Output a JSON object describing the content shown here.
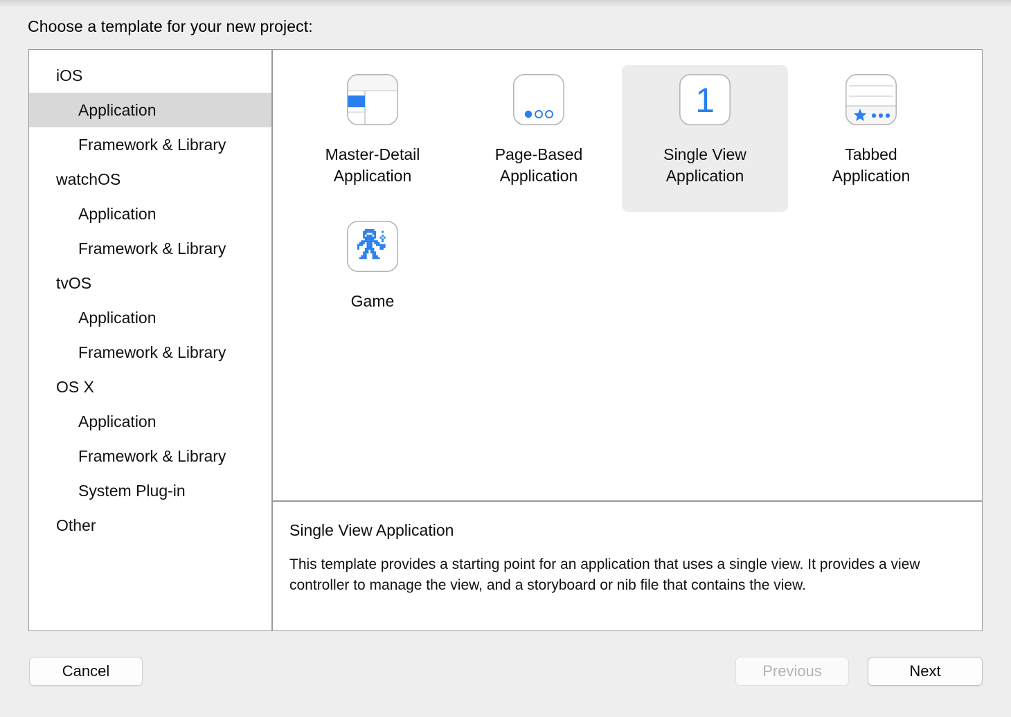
{
  "dialog": {
    "prompt": "Choose a template for your new project:"
  },
  "sidebar": {
    "rows": [
      {
        "label": "iOS",
        "level": "group",
        "selected": false
      },
      {
        "label": "Application",
        "level": "child",
        "selected": true
      },
      {
        "label": "Framework & Library",
        "level": "child",
        "selected": false
      },
      {
        "label": "watchOS",
        "level": "group",
        "selected": false
      },
      {
        "label": "Application",
        "level": "child",
        "selected": false
      },
      {
        "label": "Framework & Library",
        "level": "child",
        "selected": false
      },
      {
        "label": "tvOS",
        "level": "group",
        "selected": false
      },
      {
        "label": "Application",
        "level": "child",
        "selected": false
      },
      {
        "label": "Framework & Library",
        "level": "child",
        "selected": false
      },
      {
        "label": "OS X",
        "level": "group",
        "selected": false
      },
      {
        "label": "Application",
        "level": "child",
        "selected": false
      },
      {
        "label": "Framework & Library",
        "level": "child",
        "selected": false
      },
      {
        "label": "System Plug-in",
        "level": "child",
        "selected": false
      },
      {
        "label": "Other",
        "level": "group",
        "selected": false
      }
    ]
  },
  "templates": [
    {
      "label": "Master-Detail\nApplication",
      "icon": "master-detail-icon",
      "selected": false
    },
    {
      "label": "Page-Based\nApplication",
      "icon": "page-based-icon",
      "selected": false
    },
    {
      "label": "Single View\nApplication",
      "icon": "single-view-icon",
      "selected": true
    },
    {
      "label": "Tabbed\nApplication",
      "icon": "tabbed-icon",
      "selected": false
    },
    {
      "label": "Game",
      "icon": "game-robot-icon",
      "selected": false
    }
  ],
  "description": {
    "title": "Single View Application",
    "body": "This template provides a starting point for an application that uses a single view. It provides a view controller to manage the view, and a storyboard or nib file that contains the view."
  },
  "footer": {
    "cancel_label": "Cancel",
    "previous_label": "Previous",
    "next_label": "Next"
  },
  "colors": {
    "accent_blue": "#2a7ff0",
    "selection_gray": "#d8d8d8",
    "tile_selection_gray": "#ececec",
    "border_gray": "#9a9a9a",
    "window_background": "#eeeeee"
  },
  "single_view_icon_glyph": "1"
}
